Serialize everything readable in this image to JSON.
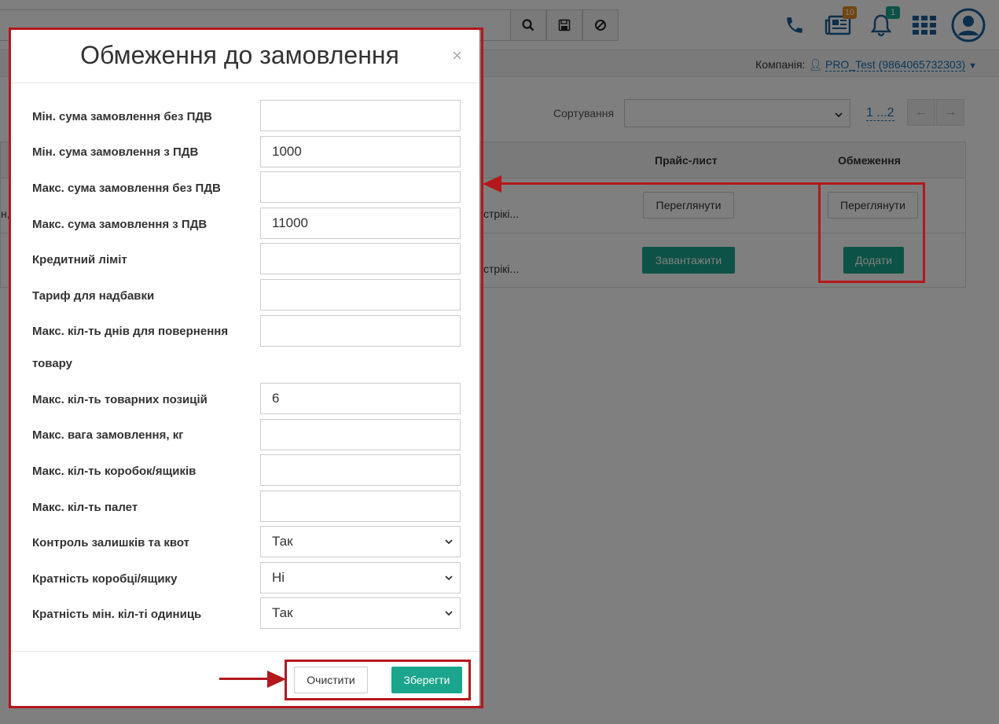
{
  "topbar": {
    "badges": {
      "news": "10",
      "notifications": "1"
    },
    "icons": [
      "search-icon",
      "save-icon",
      "block-icon",
      "phone-icon",
      "newspaper-icon",
      "bell-icon",
      "apps-grid-icon",
      "user-avatar-icon"
    ]
  },
  "company": {
    "label": "Компанія:",
    "value": "PRO_Test (9864065732303)"
  },
  "toolbar": {
    "sort_label": "Сортування",
    "sort_value": "",
    "pager": "1 ...2"
  },
  "table": {
    "headers": {
      "price_list": "Прайс-лист",
      "limits": "Обмеження"
    },
    "rows": [
      {
        "left_fragment": "н,",
        "mid_fragment": "стрікі...",
        "price_button": "Переглянути",
        "limits_button": "Переглянути"
      },
      {
        "left_fragment": "",
        "mid_fragment": "стрікі...",
        "price_button": "Завантажити",
        "limits_button": "Додати"
      }
    ]
  },
  "modal": {
    "title": "Обмеження до замовлення",
    "close": "×",
    "fields": [
      {
        "label": "Мін. сума замовлення без ПДВ",
        "value": ""
      },
      {
        "label": "Мін. сума замовлення з ПДВ",
        "value": "1000"
      },
      {
        "label": "Макс. сума замовлення без ПДВ",
        "value": ""
      },
      {
        "label": "Макс. сума замовлення з ПДВ",
        "value": "11000"
      },
      {
        "label": "Кредитний ліміт",
        "value": ""
      },
      {
        "label": "Тариф для надбавки",
        "value": ""
      },
      {
        "label": "Макс. кіл-ть днів для повернення",
        "label2": "товару",
        "value": ""
      },
      {
        "label": "Макс. кіл-ть товарних позицій",
        "value": "6"
      },
      {
        "label": "Макс. вага замовлення, кг",
        "value": ""
      },
      {
        "label": "Макс. кіл-ть коробок/ящиків",
        "value": ""
      },
      {
        "label": "Макс. кіл-ть палет",
        "value": ""
      }
    ],
    "selects": [
      {
        "label": "Контроль залишків та квот",
        "value": "Так"
      },
      {
        "label": "Кратність коробці/ящику",
        "value": "Ні"
      },
      {
        "label": "Кратність мін. кіл-ті одиниць",
        "value": "Так"
      }
    ],
    "clear_label": "Очистити",
    "save_label": "Зберегти"
  },
  "colors": {
    "accent": "#1aa58c",
    "annotation": "#b3181d",
    "link": "#1b6fb5",
    "badge_orange": "#e08a1e",
    "badge_green": "#1aa58c",
    "icon_blue": "#1b5e96"
  }
}
